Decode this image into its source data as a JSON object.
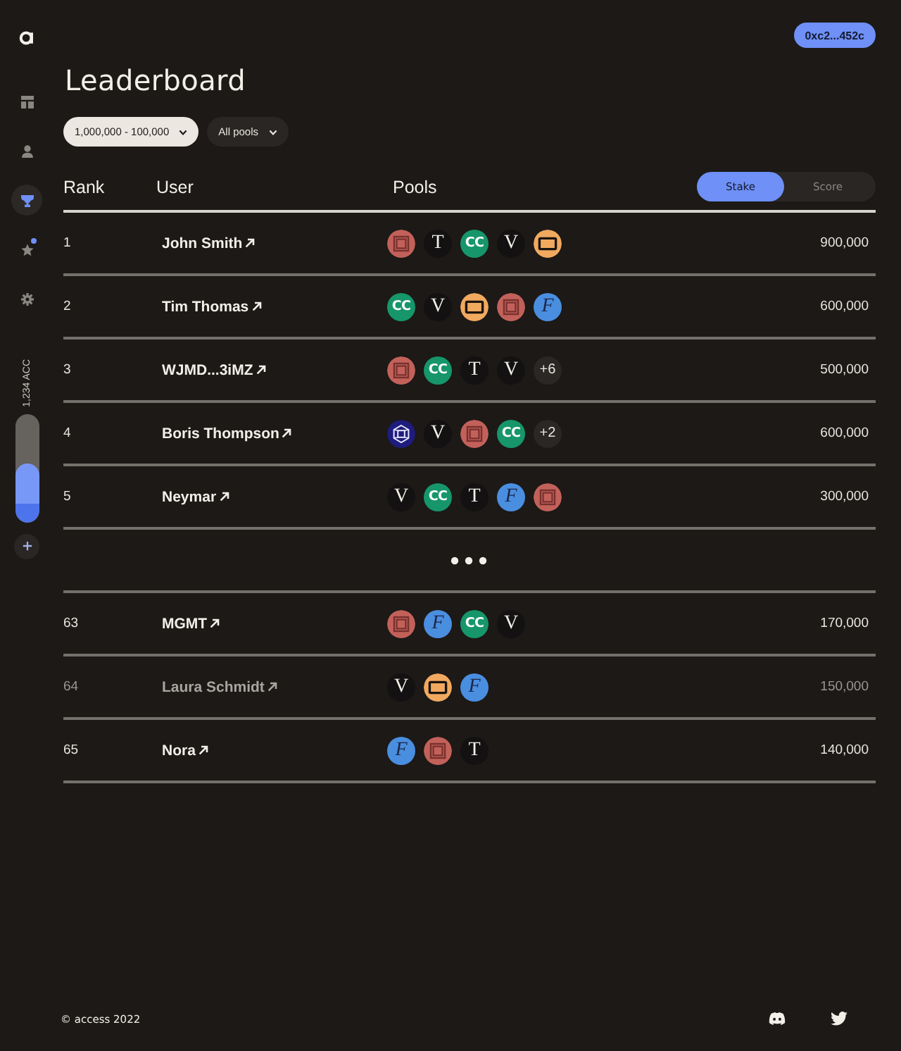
{
  "sidebar": {
    "items": [
      {
        "kind": "grid",
        "selected": false,
        "notification": false
      },
      {
        "kind": "person",
        "selected": false,
        "notification": false
      },
      {
        "kind": "trophy",
        "selected": true,
        "notification": false
      },
      {
        "kind": "star",
        "selected": false,
        "notification": true
      },
      {
        "kind": "gear",
        "selected": false,
        "notification": false
      }
    ],
    "balance": {
      "label": "1,234 ACC",
      "level": 0.55
    }
  },
  "wallet": {
    "address": "0xc2...452c"
  },
  "title": "Leaderboard",
  "filters": [
    {
      "label": "1,000,000 - 100,000",
      "active": true
    },
    {
      "label": "All pools",
      "active": false
    }
  ],
  "table": {
    "columns": [
      "Rank",
      "User",
      "Pools"
    ],
    "toggle": [
      {
        "label": "Stake",
        "selected": true
      },
      {
        "label": "Score",
        "selected": false
      }
    ],
    "rows": [
      {
        "kind": "entry",
        "rank": "1",
        "user": "John Smith",
        "dimmed": false,
        "value": "900,000",
        "pools": [
          {
            "kind": "frames",
            "color": "#c2615a"
          },
          {
            "kind": "serif",
            "label": "T",
            "color": "#131111"
          },
          {
            "kind": "sans",
            "label": "CC",
            "color": "#16966a"
          },
          {
            "kind": "serif",
            "label": "V",
            "color": "#131111"
          },
          {
            "kind": "screen",
            "color": "#f1a95f"
          }
        ]
      },
      {
        "kind": "entry",
        "rank": "2",
        "user": "Tim Thomas",
        "dimmed": false,
        "value": "600,000",
        "pools": [
          {
            "kind": "sans",
            "label": "CC",
            "color": "#16966a"
          },
          {
            "kind": "serif",
            "label": "V",
            "color": "#131111"
          },
          {
            "kind": "screen",
            "color": "#f1a95f"
          },
          {
            "kind": "frames",
            "color": "#c2615a"
          },
          {
            "kind": "script",
            "label": "F",
            "color": "#4a8ee0"
          }
        ]
      },
      {
        "kind": "entry",
        "rank": "3",
        "user": "WJMD...3iMZ",
        "dimmed": false,
        "value": "500,000",
        "pools": [
          {
            "kind": "frames",
            "color": "#c2615a"
          },
          {
            "kind": "sans",
            "label": "CC",
            "color": "#16966a"
          },
          {
            "kind": "serif",
            "label": "T",
            "color": "#131111"
          },
          {
            "kind": "serif",
            "label": "V",
            "color": "#131111"
          },
          {
            "kind": "more",
            "label": "+6"
          }
        ]
      },
      {
        "kind": "entry",
        "rank": "4",
        "user": "Boris Thompson",
        "dimmed": false,
        "value": "600,000",
        "pools": [
          {
            "kind": "cube",
            "color": "#1e1c7c"
          },
          {
            "kind": "serif",
            "label": "V",
            "color": "#131111"
          },
          {
            "kind": "frames",
            "color": "#c2615a"
          },
          {
            "kind": "sans",
            "label": "CC",
            "color": "#16966a"
          },
          {
            "kind": "more",
            "label": "+2"
          }
        ]
      },
      {
        "kind": "entry",
        "rank": "5",
        "user": "Neymar",
        "dimmed": false,
        "value": "300,000",
        "pools": [
          {
            "kind": "serif",
            "label": "V",
            "color": "#131111"
          },
          {
            "kind": "sans",
            "label": "CC",
            "color": "#16966a"
          },
          {
            "kind": "serif",
            "label": "T",
            "color": "#131111"
          },
          {
            "kind": "script",
            "label": "F",
            "color": "#4a8ee0"
          },
          {
            "kind": "frames",
            "color": "#c2615a"
          }
        ]
      },
      {
        "kind": "gap"
      },
      {
        "kind": "entry",
        "rank": "63",
        "user": "MGMT",
        "dimmed": false,
        "value": "170,000",
        "pools": [
          {
            "kind": "frames",
            "color": "#c2615a"
          },
          {
            "kind": "script",
            "label": "F",
            "color": "#4a8ee0"
          },
          {
            "kind": "sans",
            "label": "CC",
            "color": "#16966a"
          },
          {
            "kind": "serif",
            "label": "V",
            "color": "#131111"
          }
        ]
      },
      {
        "kind": "entry",
        "rank": "64",
        "user": "Laura Schmidt",
        "dimmed": true,
        "value": "150,000",
        "pools": [
          {
            "kind": "serif",
            "label": "V",
            "color": "#131111"
          },
          {
            "kind": "screen",
            "color": "#f1a95f"
          },
          {
            "kind": "script",
            "label": "F",
            "color": "#4a8ee0"
          }
        ]
      },
      {
        "kind": "entry",
        "rank": "65",
        "user": "Nora",
        "dimmed": false,
        "value": "140,000",
        "pools": [
          {
            "kind": "script",
            "label": "F",
            "color": "#4a8ee0"
          },
          {
            "kind": "frames",
            "color": "#c2615a"
          },
          {
            "kind": "serif",
            "label": "T",
            "color": "#131111"
          }
        ]
      }
    ]
  },
  "footer": {
    "copyright": "© access 2022",
    "social": [
      {
        "kind": "discord"
      },
      {
        "kind": "twitter"
      }
    ]
  }
}
